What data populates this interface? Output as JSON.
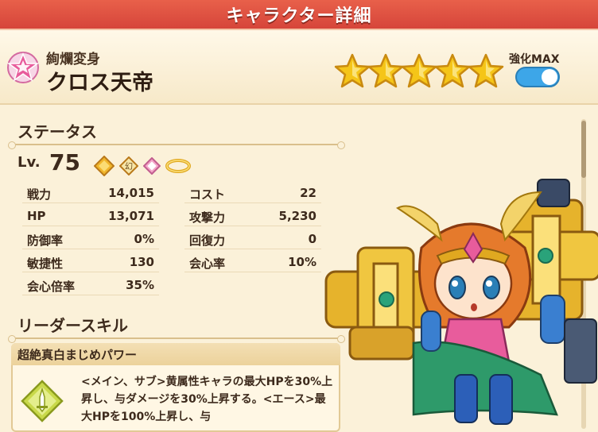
{
  "window": {
    "title": "キャラクター詳細"
  },
  "character": {
    "subtitle": "絢爛変身",
    "name": "クロス天帝",
    "star_count": 5,
    "toggle_label": "強化MAX",
    "toggle_on": true
  },
  "status": {
    "section_title": "ステータス",
    "level_label": "Lv.",
    "level_value": "75",
    "icons": [
      "gold-diamond-icon",
      "phantom-element-icon",
      "pink-gem-icon",
      "gold-ring-icon"
    ],
    "left": [
      {
        "key": "戦力",
        "value": "14,015"
      },
      {
        "key": "HP",
        "value": "13,071"
      },
      {
        "key": "防御率",
        "value": "0%"
      },
      {
        "key": "敏捷性",
        "value": "130"
      },
      {
        "key": "会心倍率",
        "value": "35%"
      }
    ],
    "right": [
      {
        "key": "コスト",
        "value": "22"
      },
      {
        "key": "攻撃力",
        "value": "5,230"
      },
      {
        "key": "回復力",
        "value": "0"
      },
      {
        "key": "会心率",
        "value": "10%"
      }
    ]
  },
  "leader_skill": {
    "section_title": "リーダースキル",
    "name": "超絶真白まじめパワー",
    "description": "<メイン、サブ>黄属性キャラの最大HPを30%上昇し、与ダメージを30%上昇する。<エース>最大HPを100%上昇し、与"
  },
  "colors": {
    "header_red": "#d6453a",
    "toggle_blue": "#3da6e8",
    "star_gold": "#f5c518"
  }
}
